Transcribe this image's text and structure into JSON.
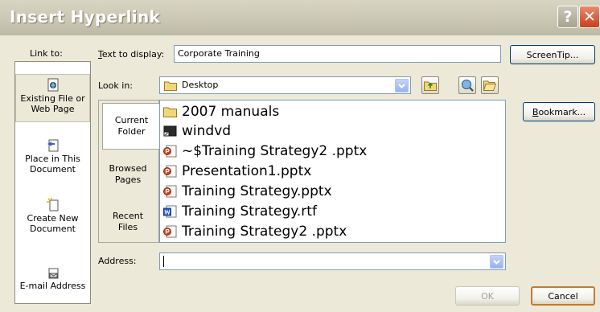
{
  "dialog": {
    "title": "Insert Hyperlink",
    "help_glyph": "?",
    "close_glyph": "✕"
  },
  "link_to": {
    "label": "Link to:",
    "items": [
      {
        "line1": "Existing File or",
        "line2": "Web Page",
        "selected": true,
        "icon": "existing-file-icon"
      },
      {
        "line1": "Place in This",
        "line2": "Document",
        "selected": false,
        "icon": "place-in-document-icon"
      },
      {
        "line1": "Create New",
        "line2": "Document",
        "selected": false,
        "icon": "create-new-document-icon"
      },
      {
        "line1": "E-mail Address",
        "line2": "",
        "selected": false,
        "icon": "email-address-icon"
      }
    ]
  },
  "text_to_display": {
    "label": "Text to display:",
    "value": "Corporate Training"
  },
  "screentip_button": "ScreenTip...",
  "look_in": {
    "label": "Look in:",
    "value": "Desktop"
  },
  "bookmark_button": "Bookmark...",
  "tabs": [
    {
      "line1": "Current",
      "line2": "Folder",
      "selected": true
    },
    {
      "line1": "Browsed",
      "line2": "Pages",
      "selected": false
    },
    {
      "line1": "Recent",
      "line2": "Files",
      "selected": false
    }
  ],
  "files": [
    {
      "name": "2007 manuals",
      "icon": "folder-icon"
    },
    {
      "name": "windvd",
      "icon": "shortcut-icon"
    },
    {
      "name": "~$Training Strategy2 .pptx",
      "icon": "powerpoint-file-icon"
    },
    {
      "name": "Presentation1.pptx",
      "icon": "powerpoint-file-icon"
    },
    {
      "name": "Training Strategy.pptx",
      "icon": "powerpoint-file-icon"
    },
    {
      "name": "Training Strategy.rtf",
      "icon": "word-file-icon"
    },
    {
      "name": "Training Strategy2 .pptx",
      "icon": "powerpoint-file-icon"
    }
  ],
  "address": {
    "label": "Address:",
    "value": ""
  },
  "ok_button": "OK",
  "cancel_button": "Cancel"
}
